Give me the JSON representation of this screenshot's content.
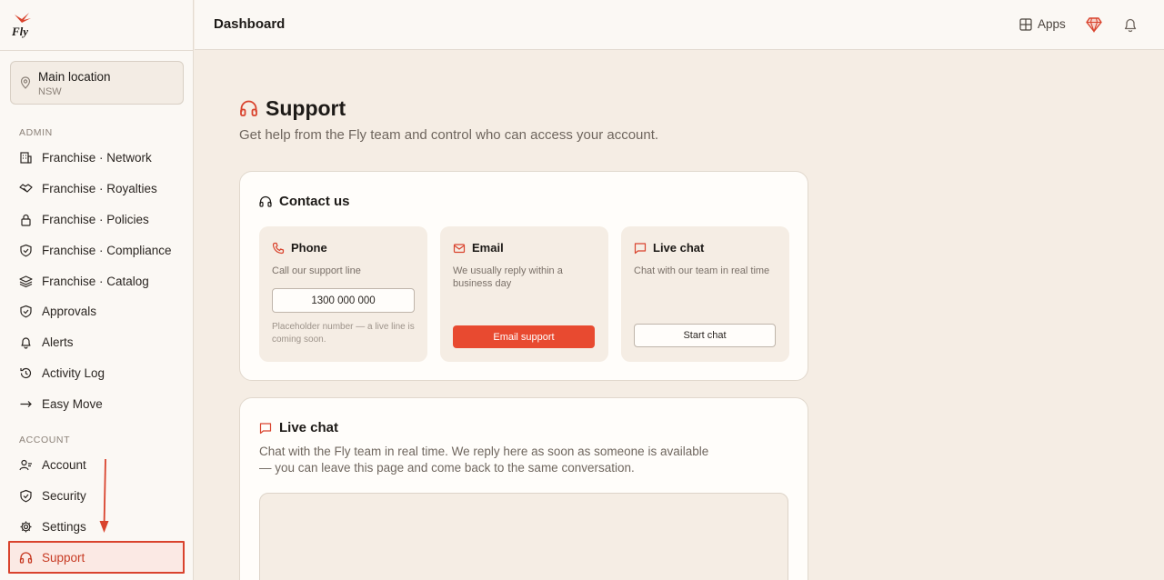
{
  "app": {
    "logo_text": "Fly"
  },
  "location": {
    "name": "Main location",
    "sub": "NSW"
  },
  "sidebar": {
    "admin_label": "ADMIN",
    "account_label": "ACCOUNT",
    "admin_items": [
      {
        "label": "Franchise · Network",
        "icon": "building-icon"
      },
      {
        "label": "Franchise · Royalties",
        "icon": "handshake-icon"
      },
      {
        "label": "Franchise · Policies",
        "icon": "lock-icon"
      },
      {
        "label": "Franchise · Compliance",
        "icon": "shield-icon"
      },
      {
        "label": "Franchise · Catalog",
        "icon": "layers-icon"
      },
      {
        "label": "Approvals",
        "icon": "shield-check-icon"
      },
      {
        "label": "Alerts",
        "icon": "bell-icon"
      },
      {
        "label": "Activity Log",
        "icon": "history-icon"
      },
      {
        "label": "Easy Move",
        "icon": "arrow-right-icon"
      }
    ],
    "account_items": [
      {
        "label": "Account",
        "icon": "user-icon"
      },
      {
        "label": "Security",
        "icon": "shield-icon"
      },
      {
        "label": "Settings",
        "icon": "gear-icon"
      },
      {
        "label": "Support",
        "icon": "headphones-icon",
        "active": true
      }
    ]
  },
  "header": {
    "title": "Dashboard",
    "apps_label": "Apps"
  },
  "page": {
    "title": "Support",
    "subtitle": "Get help from the Fly team and control who can access your account."
  },
  "contact": {
    "title": "Contact us",
    "phone": {
      "title": "Phone",
      "desc": "Call our support line",
      "number": "1300 000 000",
      "note": "Placeholder number — a live line is coming soon."
    },
    "email": {
      "title": "Email",
      "desc": "We usually reply within a business day",
      "button": "Email support"
    },
    "chat": {
      "title": "Live chat",
      "desc": "Chat with our team in real time",
      "button": "Start chat"
    }
  },
  "live_chat": {
    "title": "Live chat",
    "desc": "Chat with the Fly team in real time. We reply here as soon as someone is available — you can leave this page and come back to the same conversation."
  },
  "colors": {
    "accent": "#e84a30",
    "background": "#f5ede4",
    "panel": "#fbf8f4"
  }
}
